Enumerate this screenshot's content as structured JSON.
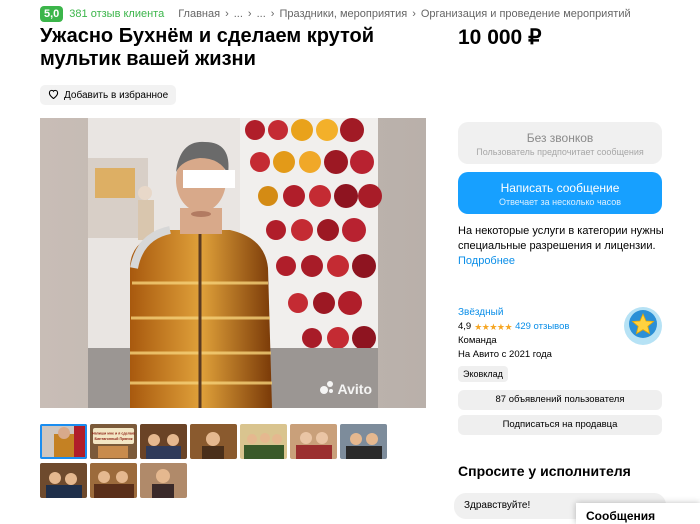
{
  "breadcrumbs": {
    "rating": "5,0",
    "reviews": "381 отзыв клиента",
    "items": [
      "Главная",
      "...",
      "...",
      "Праздники, мероприятия",
      "Организация и проведение мероприятий"
    ],
    "separator": "›"
  },
  "listing": {
    "title": "Ужасно Бухнём и сделаем крутой мультик вашей жизни",
    "price": "10 000 ₽",
    "favorite_label": "Добавить в избранное",
    "watermark": "Avito"
  },
  "actions": {
    "no_calls_title": "Без звонков",
    "no_calls_subtitle": "Пользователь предпочитает сообщения",
    "write_title": "Написать сообщение",
    "write_subtitle": "Отвечает за несколько часов",
    "accent": "#17a0ff"
  },
  "licence": {
    "text": "На некоторые услуги в категории нужны специальные разрешения и лицензии.",
    "more": "Подробнее"
  },
  "seller": {
    "name": "Звёздный",
    "rating": "4,9",
    "reviews": "429 отзывов",
    "type": "Команда",
    "since": "На Авито с 2021 года",
    "tag": "Эковклад",
    "ads_button": "87 объявлений пользователя",
    "subscribe_button": "Подписаться на продавца"
  },
  "ask": {
    "title": "Спросите у исполнителя",
    "quick_message": "Здравствуйте!",
    "messages": "Сообщения"
  },
  "thumbnails": {
    "captions": [
      "",
      "Напиши мне и я сделаю Бинтагонный Пряник",
      "",
      "",
      "",
      "",
      "",
      "",
      "",
      ""
    ]
  }
}
